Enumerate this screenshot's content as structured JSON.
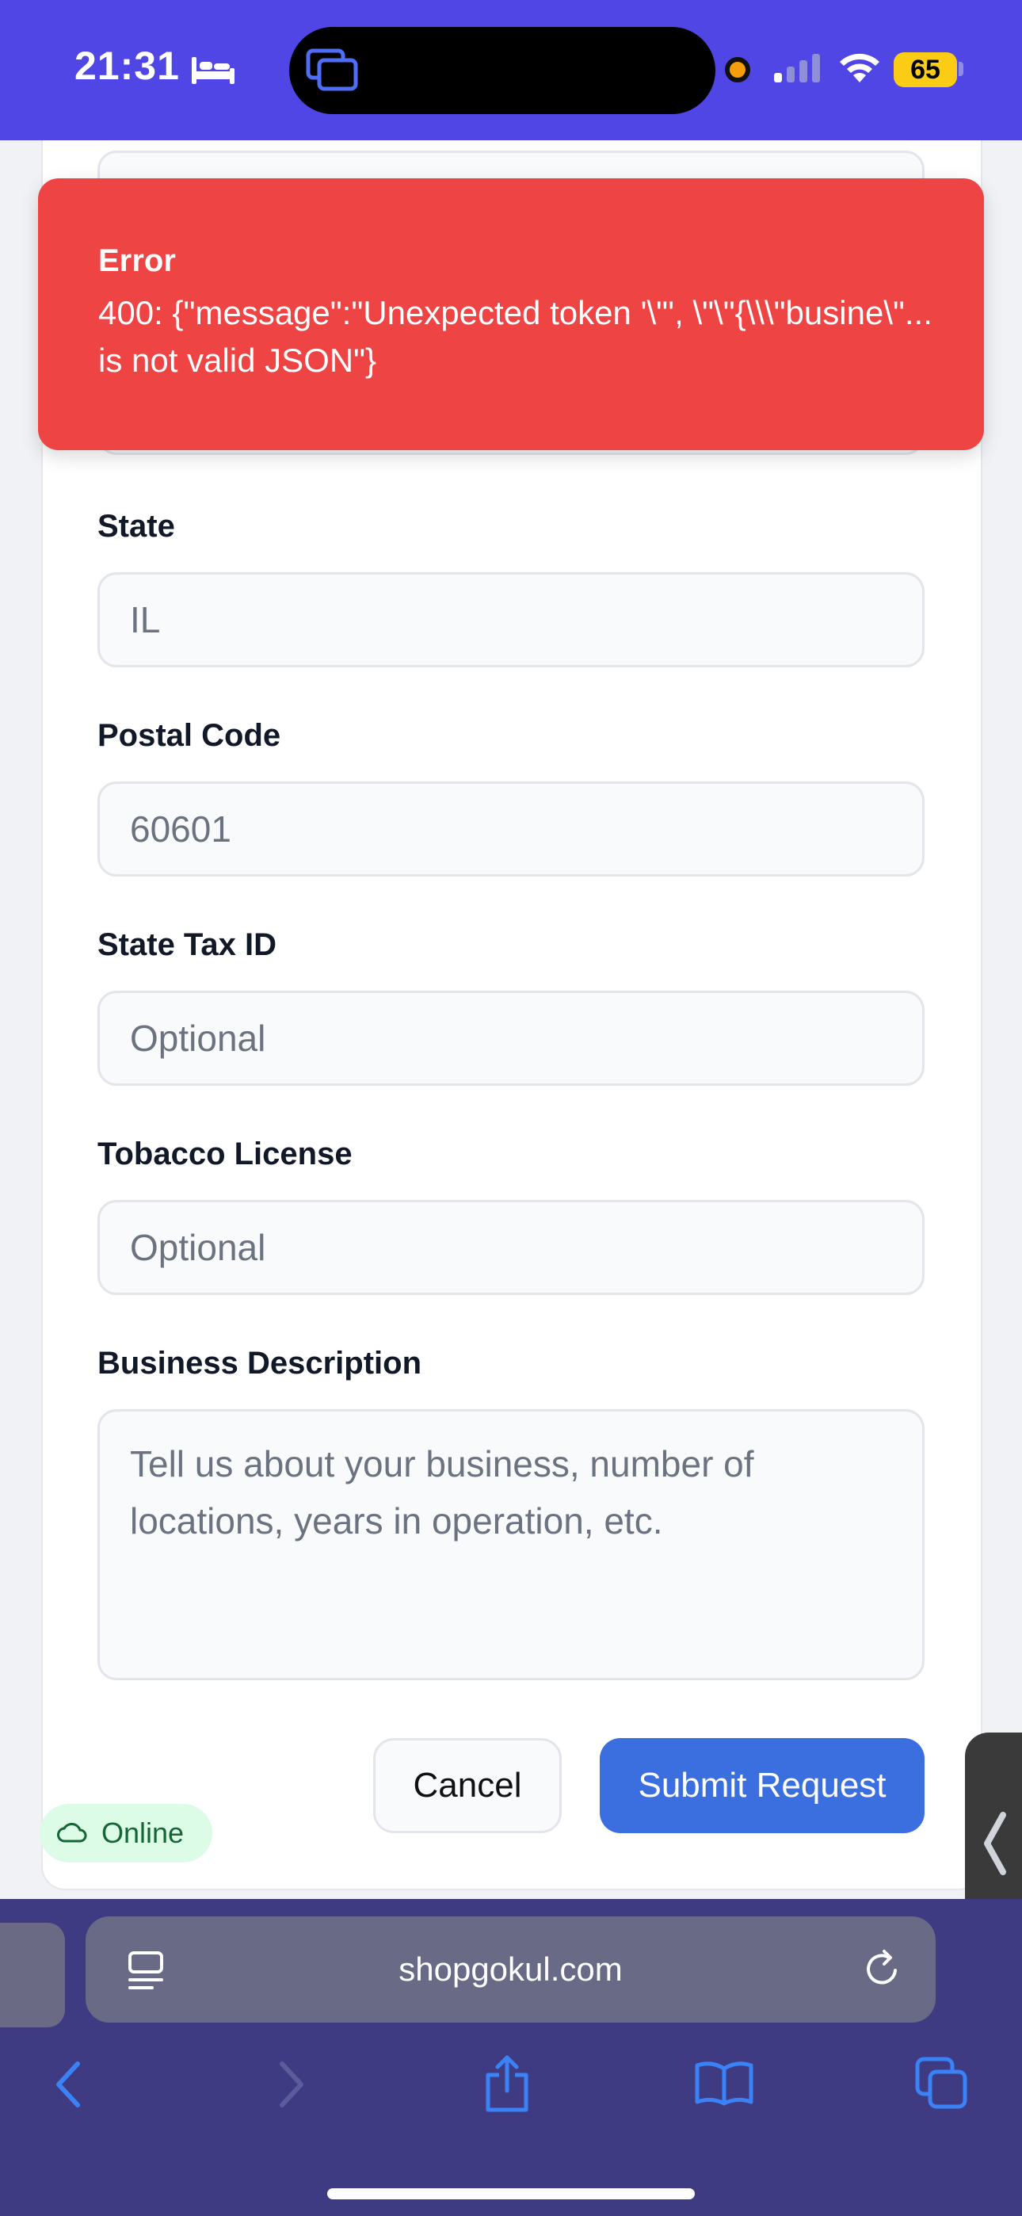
{
  "status_bar": {
    "time": "21:31",
    "battery": "65",
    "icons": [
      "bed-icon",
      "screen-mirror-icon",
      "recording-dot-icon",
      "signal-icon",
      "wifi-icon",
      "battery-icon"
    ],
    "accent_color": "#4f46e5"
  },
  "error_toast": {
    "title": "Error",
    "message": "400: {\"message\":\"Unexpected token '\\\"', \\\"\\\"{\\\\\\\"busine\\\"... is not valid JSON\"}",
    "color": "#ef4444"
  },
  "form": {
    "state_label": "State",
    "state_value": "IL",
    "postal_label": "Postal Code",
    "postal_value": "60601",
    "tax_label": "State Tax ID",
    "tax_placeholder": "Optional",
    "tobacco_label": "Tobacco License",
    "tobacco_placeholder": "Optional",
    "desc_label": "Business Description",
    "desc_placeholder": "Tell us about your business, number of locations, years in operation, etc.",
    "cancel_label": "Cancel",
    "submit_label": "Submit Request",
    "submit_color": "#3b6fe0"
  },
  "status_badge": {
    "label": "Online",
    "icon": "cloud-icon"
  },
  "browser": {
    "url": "shopgokul.com",
    "toolbar_icons": [
      "back-icon",
      "forward-icon",
      "share-icon",
      "bookmarks-icon",
      "tabs-icon"
    ]
  }
}
